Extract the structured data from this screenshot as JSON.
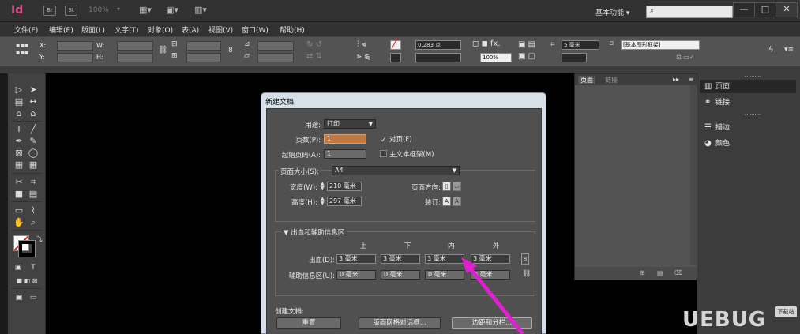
{
  "app": {
    "logo": "Id",
    "bridge_btn": "Br",
    "stock_btn": "St",
    "zoom": "100%",
    "workspace_label": "基本功能 ▾",
    "search_placeholder": "",
    "win_minimize": "—",
    "win_maximize": "□",
    "win_close": "✕"
  },
  "menu": [
    "文件(F)",
    "编辑(E)",
    "版面(L)",
    "文字(T)",
    "对象(O)",
    "表(A)",
    "视图(V)",
    "窗口(W)",
    "帮助(H)"
  ],
  "control": {
    "x_label": "X:",
    "y_label": "Y:",
    "w_label": "W:",
    "h_label": "H:",
    "stroke_weight": "0.283 点",
    "opacity": "100%",
    "frame_style": "[基本图形框架]",
    "tool_hint": "5 毫米"
  },
  "tools": [
    "selection-tool",
    "direct-selection-tool",
    "page-tool",
    "gap-tool",
    "content-collector-tool",
    "content-placer-tool",
    "type-tool",
    "line-tool",
    "pen-tool",
    "pencil-tool",
    "rectangle-frame-tool",
    "ellipse-tool",
    "table-tool",
    "grid-tool",
    "scissors-tool",
    "free-transform-tool",
    "gradient-swatch-tool",
    "gradient-feather-tool",
    "note-tool",
    "eyedropper-tool",
    "hand-tool",
    "zoom-tool"
  ],
  "tool_glyphs": [
    "▷",
    "➤",
    "▤",
    "↔",
    "⌂",
    "⌂",
    "T",
    "╱",
    "✒",
    "✎",
    "⊠",
    "◯",
    "▦",
    "▦",
    "✂",
    "⌗",
    "■",
    "▤",
    "▭",
    "⌇",
    "✋",
    "🔍"
  ],
  "panel": {
    "tab_pages": "页面",
    "tab_links": "链接"
  },
  "dock": {
    "items": [
      "页面",
      "链接",
      "描边",
      "颜色"
    ],
    "icons": [
      "page-icon",
      "link-icon",
      "stroke-icon",
      "color-icon"
    ]
  },
  "dialog": {
    "title": "新建文档",
    "intent_label": "用途:",
    "intent_value": "打印",
    "pages_label": "页数(P):",
    "pages_value": "1",
    "facing_label": "对页(F)",
    "facing_checked": true,
    "start_page_label": "起始页码(A):",
    "start_page_value": "1",
    "master_frame_label": "主文本框架(M)",
    "master_frame_checked": false,
    "page_size_label": "页面大小(S):",
    "page_size_value": "A4",
    "width_label": "宽度(W):",
    "width_value": "210 毫米",
    "height_label": "高度(H):",
    "height_value": "297 毫米",
    "orientation_label": "页面方向:",
    "binding_label": "装订:",
    "bleed_section_label": "出血和辅助信息区",
    "columns": [
      "上",
      "下",
      "内",
      "外"
    ],
    "bleed_label": "出血(D):",
    "bleed_values": [
      "3 毫米",
      "3 毫米",
      "3 毫米",
      "3 毫米"
    ],
    "slug_label": "辅助信息区(U):",
    "slug_values": [
      "0 毫米",
      "0 毫米",
      "0 毫米",
      "0 毫米"
    ],
    "create_label": "创建文档:",
    "btn_reset": "重置",
    "btn_layout_grid": "版面网格对话框...",
    "btn_margins": "边距和分栏..."
  },
  "watermark": {
    "text": "UEBUG",
    "badge": "下载站"
  },
  "colors": {
    "arrow": "#e020d0",
    "logo": "#e0498a"
  }
}
